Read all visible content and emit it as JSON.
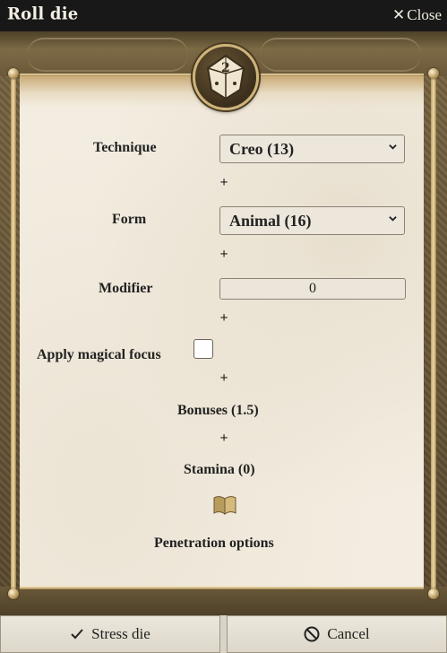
{
  "window": {
    "title": "Roll die",
    "close_label": "Close"
  },
  "medallion": {
    "die_face": "2"
  },
  "form": {
    "technique": {
      "label": "Technique",
      "value": "Creo (13)"
    },
    "plus1": "+",
    "form": {
      "label": "Form",
      "value": "Animal (16)"
    },
    "plus2": "+",
    "modifier": {
      "label": "Modifier",
      "value": "0"
    },
    "plus3": "+",
    "focus": {
      "label": "Apply magical focus",
      "checked": false
    },
    "plus4": "+",
    "bonuses": "Bonuses (1.5)",
    "plus5": "+",
    "stamina": "Stamina (0)",
    "penetration": "Penetration options"
  },
  "buttons": {
    "stress_label": "Stress die",
    "cancel_label": "Cancel"
  },
  "colors": {
    "parchment": "#f3ede1",
    "frame": "#6e5b3c",
    "gold": "#cfb37a"
  }
}
